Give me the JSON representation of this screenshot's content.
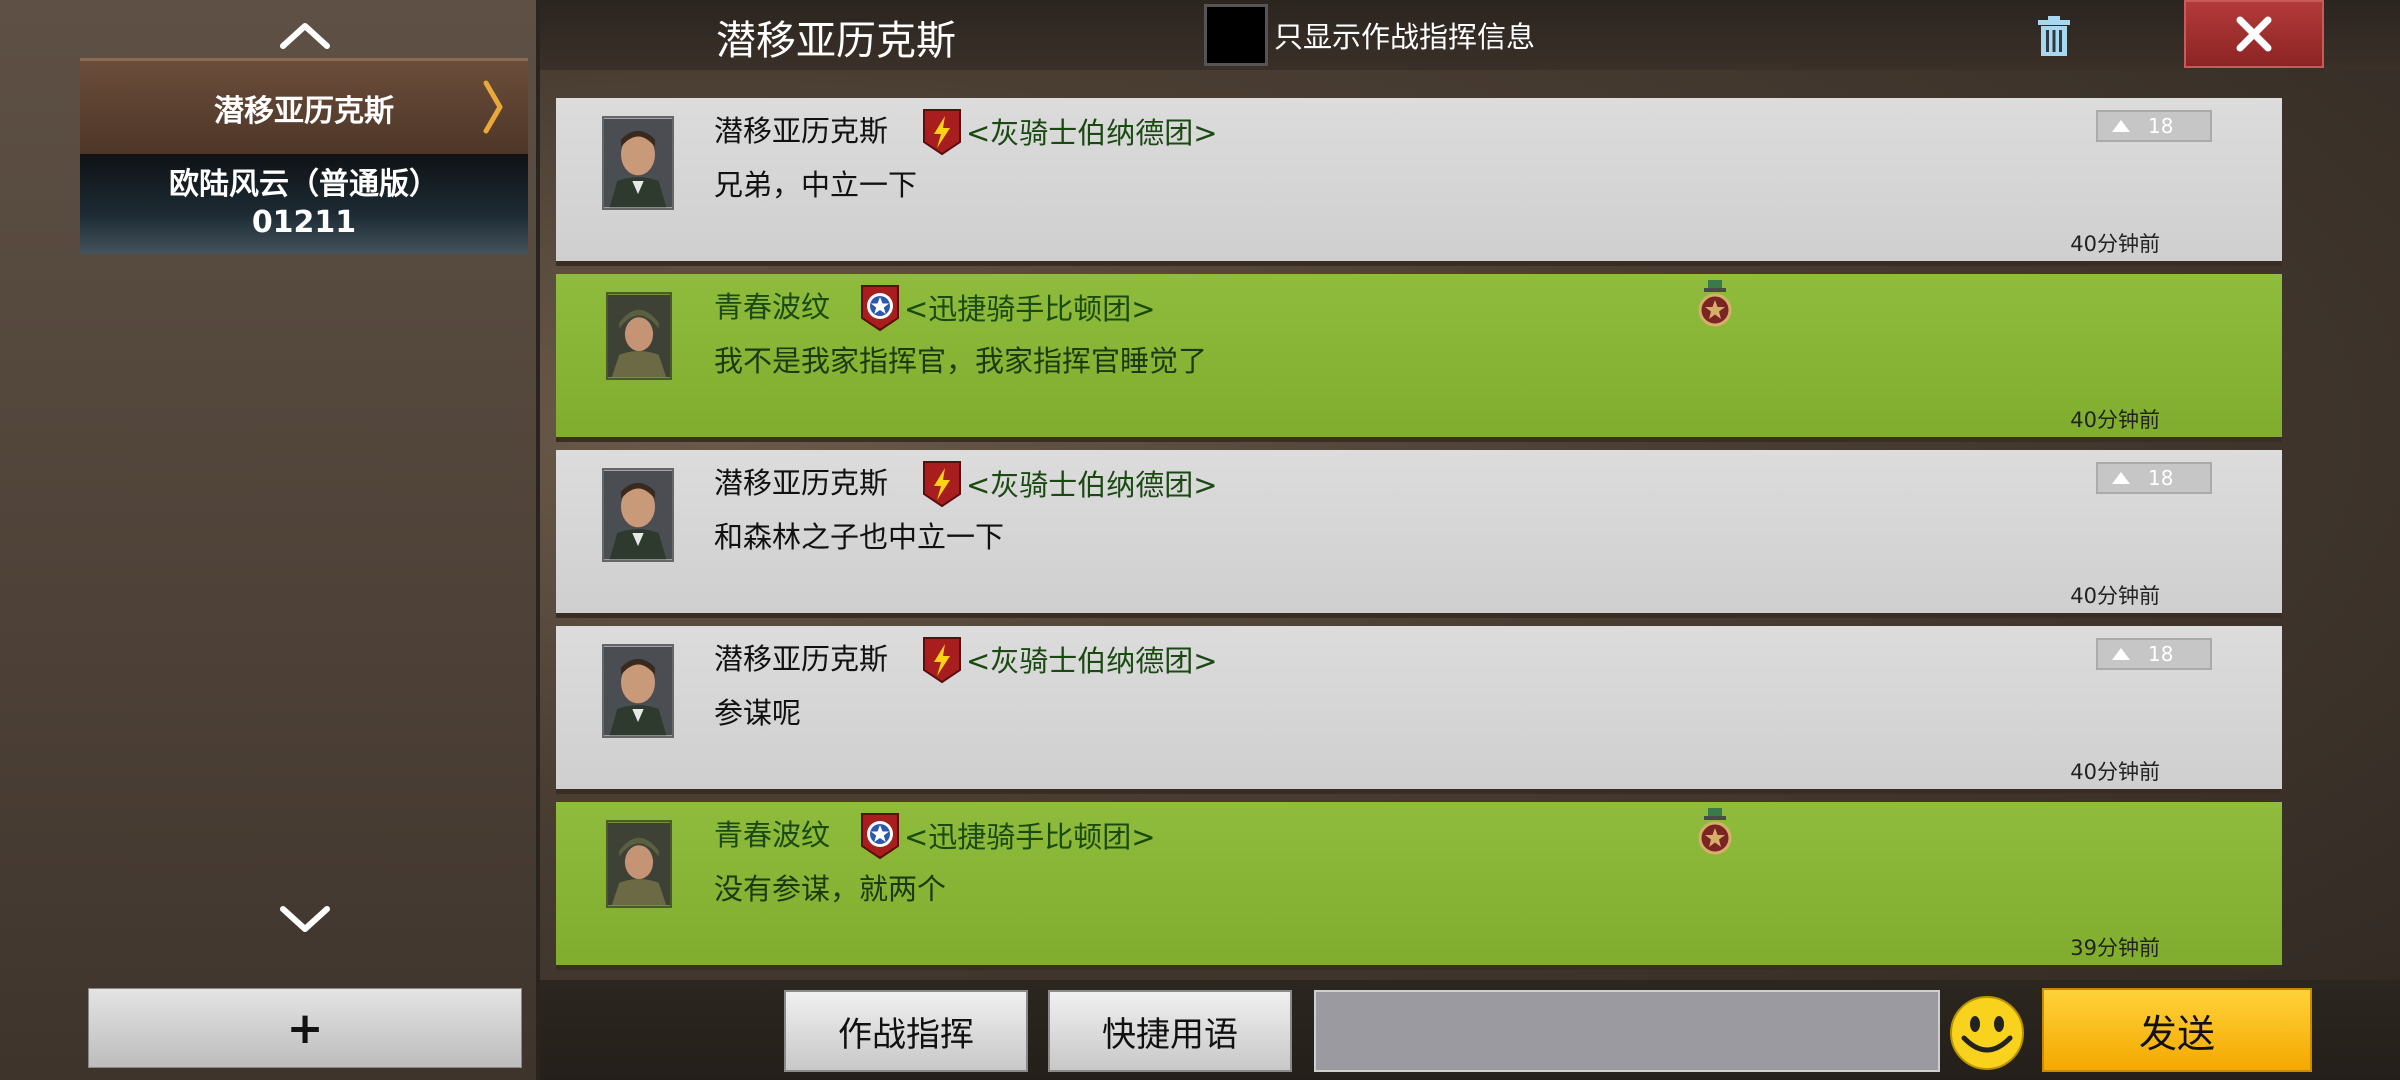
{
  "header": {
    "title": "潜移亚历克斯",
    "filter_label": "只显示作战指挥信息"
  },
  "sidebar": {
    "channels": [
      {
        "label": "潜移亚历克斯"
      },
      {
        "label": "欧陆风云（普通版）01211"
      }
    ],
    "add_label": "+"
  },
  "messages": [
    {
      "sender": "潜移亚历克斯",
      "guild": "<灰骑士伯纳德团>",
      "text": "兄弟，中立一下",
      "time": "40分钟前",
      "level": "18",
      "style": "grey"
    },
    {
      "sender": "青春波纹",
      "guild": "<迅捷骑手比顿团>",
      "text": "我不是我家指挥官，我家指挥官睡觉了",
      "time": "40分钟前",
      "style": "green"
    },
    {
      "sender": "潜移亚历克斯",
      "guild": "<灰骑士伯纳德团>",
      "text": "和森林之子也中立一下",
      "time": "40分钟前",
      "level": "18",
      "style": "grey"
    },
    {
      "sender": "潜移亚历克斯",
      "guild": "<灰骑士伯纳德团>",
      "text": "参谋呢",
      "time": "40分钟前",
      "level": "18",
      "style": "grey"
    },
    {
      "sender": "青春波纹",
      "guild": "<迅捷骑手比顿团>",
      "text": "没有参谋，就两个",
      "time": "39分钟前",
      "style": "green"
    }
  ],
  "bottom": {
    "command_label": "作战指挥",
    "phrases_label": "快捷用语",
    "input_value": "",
    "send_label": "发送"
  },
  "colors": {
    "grey_bubble": "#d6d6d6",
    "green_bubble": "#86b434",
    "send_button": "#f9bd1a",
    "close_button": "#a02f2f"
  }
}
